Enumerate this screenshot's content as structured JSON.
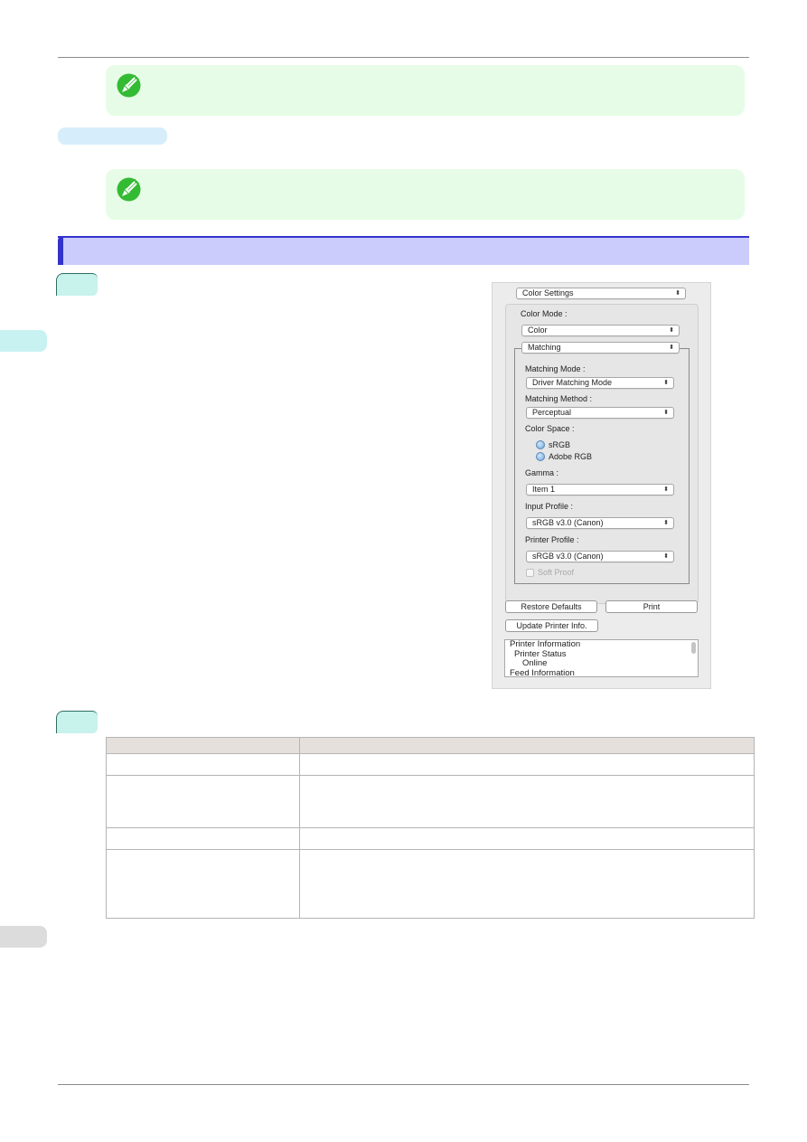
{
  "page": {
    "notes": [
      {
        "icon": "pencil-note-icon",
        "text": ""
      },
      {
        "icon": "pencil-note-icon",
        "text": ""
      }
    ],
    "pill_label": "",
    "section_heading": "",
    "steps": [
      {
        "number": ""
      },
      {
        "number": ""
      }
    ],
    "colors": {
      "note_bg": "#e6fce6",
      "note_icon": "#33bb33",
      "section_bg": "#ccccfc",
      "section_accent": "#3333cc",
      "step_bg": "#c8f2ec",
      "pill_bg": "#d6eefc",
      "table_header_bg": "#e6e0dc"
    }
  },
  "dialog": {
    "panel_select": "Color Settings",
    "color_mode_label": "Color Mode :",
    "color_mode_value": "Color",
    "group_select": "Matching",
    "matching_mode_label": "Matching Mode :",
    "matching_mode_value": "Driver Matching Mode",
    "matching_method_label": "Matching Method :",
    "matching_method_value": "Perceptual",
    "color_space_label": "Color Space :",
    "color_space_options": [
      "sRGB",
      "Adobe RGB"
    ],
    "gamma_label": "Gamma :",
    "gamma_value": "Item 1",
    "input_profile_label": "Input Profile :",
    "input_profile_value": "sRGB v3.0 (Canon)",
    "printer_profile_label": "Printer Profile :",
    "printer_profile_value": "sRGB v3.0 (Canon)",
    "soft_proof_label": "Soft Proof",
    "restore_defaults_label": "Restore Defaults",
    "print_label": "Print",
    "update_info_label": "Update Printer Info.",
    "info_lines": [
      "Printer Information",
      "  Printer Status",
      "     Online",
      "Feed Information"
    ],
    "select_arrows": "⬍"
  },
  "table": {
    "headers": [
      "",
      ""
    ],
    "rows": [
      [
        "",
        ""
      ],
      [
        "",
        ""
      ],
      [
        "",
        ""
      ],
      [
        "",
        ""
      ]
    ]
  }
}
